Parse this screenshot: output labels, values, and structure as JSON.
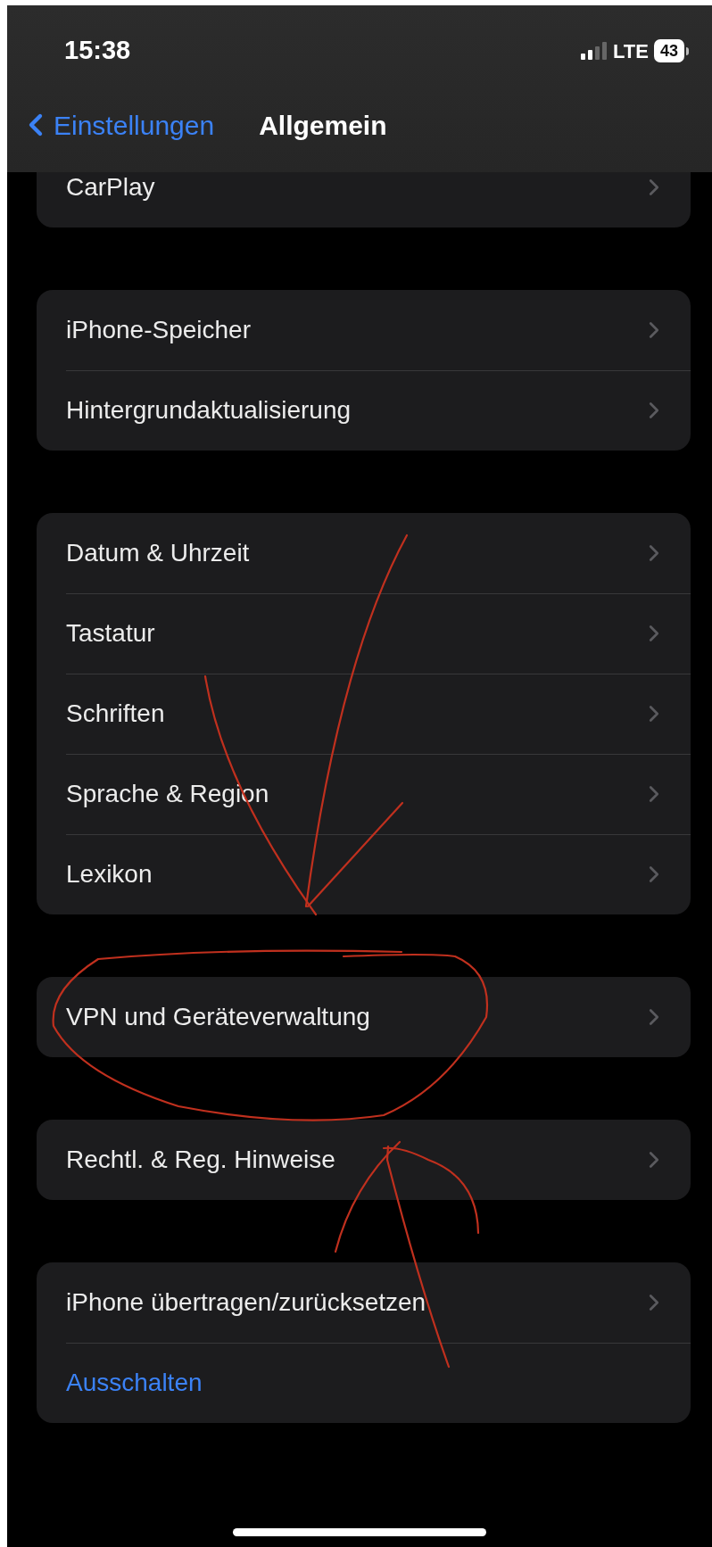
{
  "status_bar": {
    "time": "15:38",
    "network": "LTE",
    "battery": "43"
  },
  "nav": {
    "back": "Einstellungen",
    "title": "Allgemein"
  },
  "groups": [
    {
      "rows": [
        {
          "label": "CarPlay",
          "kind": "link"
        }
      ]
    },
    {
      "rows": [
        {
          "label": "iPhone-Speicher",
          "kind": "link"
        },
        {
          "label": "Hintergrundaktualisierung",
          "kind": "link"
        }
      ]
    },
    {
      "rows": [
        {
          "label": "Datum & Uhrzeit",
          "kind": "link"
        },
        {
          "label": "Tastatur",
          "kind": "link"
        },
        {
          "label": "Schriften",
          "kind": "link"
        },
        {
          "label": "Sprache & Region",
          "kind": "link"
        },
        {
          "label": "Lexikon",
          "kind": "link"
        }
      ]
    },
    {
      "rows": [
        {
          "label": "VPN und Geräteverwaltung",
          "kind": "link"
        }
      ]
    },
    {
      "rows": [
        {
          "label": "Rechtl. & Reg. Hinweise",
          "kind": "link"
        }
      ]
    },
    {
      "rows": [
        {
          "label": "iPhone übertragen/zurücksetzen",
          "kind": "link"
        },
        {
          "label": "Ausschalten",
          "kind": "action"
        }
      ]
    }
  ]
}
